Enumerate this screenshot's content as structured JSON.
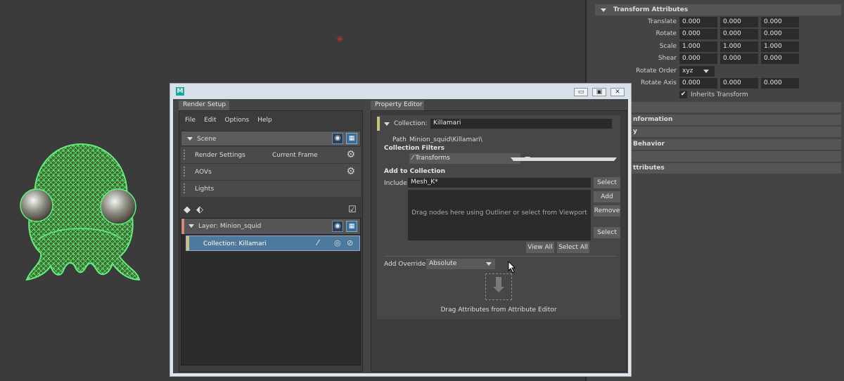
{
  "attribute_editor": {
    "section_title": "Transform Attributes",
    "rows": [
      {
        "label": "Translate",
        "values": [
          "0.000",
          "0.000",
          "0.000"
        ]
      },
      {
        "label": "Rotate",
        "values": [
          "0.000",
          "0.000",
          "0.000"
        ]
      },
      {
        "label": "Scale",
        "values": [
          "1.000",
          "1.000",
          "1.000"
        ]
      },
      {
        "label": "Shear",
        "values": [
          "0.000",
          "0.000",
          "0.000"
        ]
      }
    ],
    "rotate_order": {
      "label": "Rotate Order",
      "value": "xyz"
    },
    "rotate_axis": {
      "label": "Rotate Axis",
      "values": [
        "0.000",
        "0.000",
        "0.000"
      ]
    },
    "inherits_transform": {
      "label": "Inherits Transform",
      "checked": "✔"
    },
    "sections": [
      "nformation",
      "y",
      "Behavior",
      "",
      "ttributes"
    ]
  },
  "render_setup": {
    "app_logo": "M",
    "window_buttons": {
      "minimize": "▭",
      "restore": "▣",
      "close": "✕"
    },
    "tab": "Render Setup",
    "menu": [
      "File",
      "Edit",
      "Options",
      "Help"
    ],
    "scene": "Scene",
    "items": [
      {
        "label": "Render Settings",
        "extra": "Current Frame"
      },
      {
        "label": "AOVs",
        "extra": ""
      },
      {
        "label": "Lights",
        "extra": ""
      }
    ],
    "layer": {
      "prefix": "Layer:",
      "name": "Minion_squid"
    },
    "collection": {
      "prefix": "Collection:",
      "name": "Killamari"
    }
  },
  "property_editor": {
    "tab": "Property Editor",
    "collection_label": "Collection:",
    "collection_name": "Killamari",
    "path_label": "Path",
    "path_value": "Minion_squid\\Killamari\\",
    "filters_label": "Collection Filters",
    "filter_value": "Transforms",
    "add_label": "Add to Collection",
    "include_label": "Include",
    "include_value": "Mesh_K*",
    "drop_hint": "Drag nodes here using Outliner or select from Viewport",
    "buttons": {
      "select_top": "Select",
      "add": "Add",
      "remove": "Remove",
      "select_bottom": "Select",
      "view_all": "View All",
      "select_all": "Select All"
    },
    "override_label": "Add Override",
    "override_value": "Absolute",
    "drag_attr_hint": "Drag Attributes from Attribute Editor"
  },
  "viewport": {
    "pivot_icon": "✳"
  },
  "icons": {
    "gear": "⚙",
    "eye": "◉",
    "render": "▦",
    "create_collection": "◆",
    "create_layer": "⬖",
    "apply": "☑",
    "isolate": "◎",
    "disable": "⊘",
    "filter": "⁄"
  }
}
